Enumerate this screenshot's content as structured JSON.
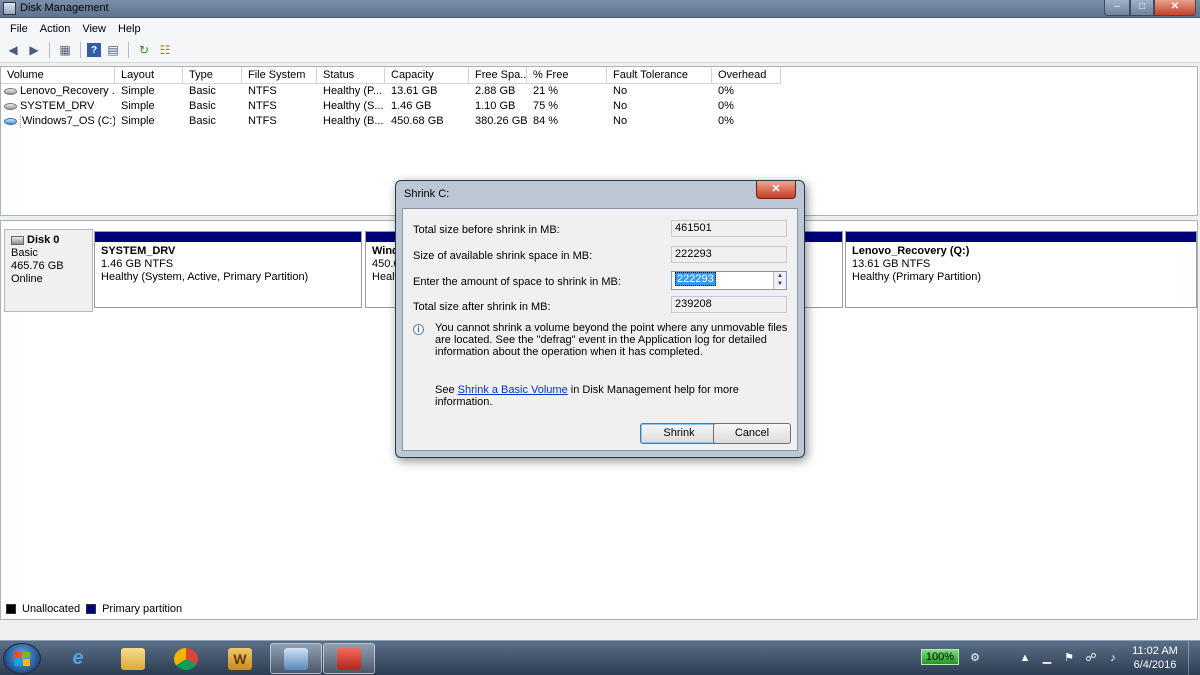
{
  "window": {
    "title": "Disk Management",
    "controls": {
      "minimize": "–",
      "maximize": "□",
      "close": "✕"
    }
  },
  "menu": [
    "File",
    "Action",
    "View",
    "Help"
  ],
  "toolbar_icons": [
    "back-icon",
    "forward-icon",
    "console-tree-icon",
    "help-icon",
    "properties-icon",
    "refresh-icon",
    "rescan-icon"
  ],
  "volumes": {
    "columns": [
      "Volume",
      "Layout",
      "Type",
      "File System",
      "Status",
      "Capacity",
      "Free Spa...",
      "% Free",
      "Fault Tolerance",
      "Overhead"
    ],
    "rows": [
      {
        "volume": "Lenovo_Recovery ...",
        "layout": "Simple",
        "type": "Basic",
        "fs": "NTFS",
        "status": "Healthy (P...",
        "capacity": "13.61 GB",
        "free": "2.88 GB",
        "pct": "21 %",
        "fault": "No",
        "overhead": "0%"
      },
      {
        "volume": "SYSTEM_DRV",
        "layout": "Simple",
        "type": "Basic",
        "fs": "NTFS",
        "status": "Healthy (S...",
        "capacity": "1.46 GB",
        "free": "1.10 GB",
        "pct": "75 %",
        "fault": "No",
        "overhead": "0%"
      },
      {
        "volume": "Windows7_OS (C:)",
        "layout": "Simple",
        "type": "Basic",
        "fs": "NTFS",
        "status": "Healthy (B...",
        "capacity": "450.68 GB",
        "free": "380.26 GB",
        "pct": "84 %",
        "fault": "No",
        "overhead": "0%"
      }
    ]
  },
  "disk": {
    "name": "Disk 0",
    "type": "Basic",
    "size": "465.76 GB",
    "state": "Online",
    "partitions": [
      {
        "name": "SYSTEM_DRV",
        "size": "1.46 GB NTFS",
        "status": "Healthy (System, Active, Primary Partition)"
      },
      {
        "name": "Wind",
        "size": "450.6",
        "status": "Healt"
      },
      {
        "name": "Lenovo_Recovery  (Q:)",
        "size": "13.61 GB NTFS",
        "status": "Healthy (Primary Partition)"
      }
    ]
  },
  "legend": [
    {
      "label": "Unallocated",
      "color": "#000000"
    },
    {
      "label": "Primary partition",
      "color": "#00007b"
    }
  ],
  "dialog": {
    "title": "Shrink C:",
    "close": "✕",
    "fields": [
      {
        "label": "Total size before shrink in MB:",
        "value": "461501"
      },
      {
        "label": "Size of available shrink space in MB:",
        "value": "222293"
      },
      {
        "label": "Enter the amount of space to shrink in MB:",
        "value": "222293"
      },
      {
        "label": "Total size after shrink in MB:",
        "value": "239208"
      }
    ],
    "note": "You cannot shrink a volume beyond the point where any unmovable files are located. See the \"defrag\" event in the Application log for detailed information about the operation when it has completed.",
    "see_prefix": "See ",
    "see_link": "Shrink a Basic Volume",
    "see_suffix": " in Disk Management help for more information.",
    "buttons": {
      "shrink": "Shrink",
      "cancel": "Cancel"
    }
  },
  "taskbar": {
    "apps": [
      "internet-explorer",
      "windows-explorer",
      "chrome",
      "word",
      "disk-management-console",
      "toolbox"
    ],
    "battery": "100%",
    "time": "11:02 AM",
    "date": "6/4/2016"
  }
}
